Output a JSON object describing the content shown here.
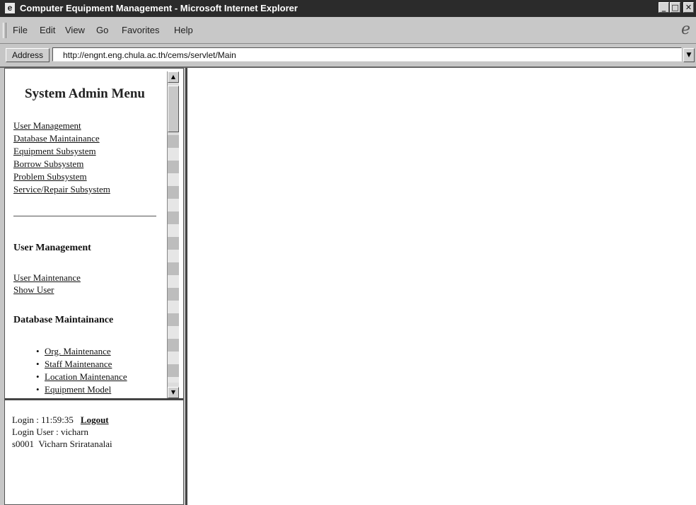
{
  "window": {
    "title": "Computer Equipment Management - Microsoft Internet Explorer"
  },
  "menubar": {
    "items": [
      "File",
      "Edit",
      "View",
      "Go",
      "Favorites",
      "Help"
    ]
  },
  "address": {
    "label": "Address",
    "url": "http://engnt.eng.chula.ac.th/cems/servlet/Main"
  },
  "sidebar": {
    "title": "System Admin Menu",
    "links": [
      "User Management",
      "Database Maintainance",
      "Equipment Subsystem",
      "Borrow Subsystem",
      "Problem Subsystem",
      "Service/Repair Subsystem"
    ],
    "user_management": {
      "heading": "User Management",
      "links": [
        "User Maintenance",
        "Show User"
      ]
    },
    "database_maintainance": {
      "heading": "Database Maintainance",
      "links": [
        "Org. Maintenance",
        "Staff Maintenance",
        "Location Maintenance",
        "Equipment Model"
      ]
    }
  },
  "login": {
    "time_text": "Login : 11:59:35",
    "logout_label": "Logout",
    "user_text": "Login User : vicharn",
    "staff_text": "s0001  Vicharn Sriratanalai"
  }
}
